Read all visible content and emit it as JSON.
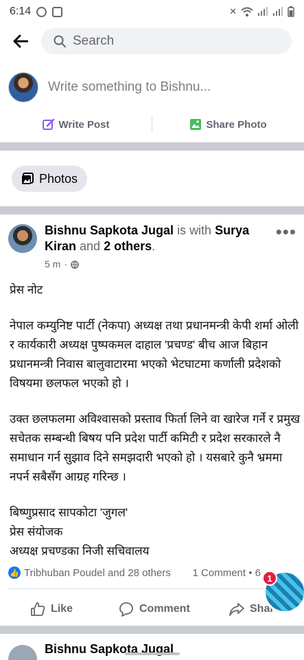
{
  "status": {
    "time": "6:14",
    "icons": [
      "whatsapp-icon",
      "screen-icon",
      "mute-icon",
      "wifi-icon",
      "signal-icon",
      "signal-icon"
    ]
  },
  "topbar": {
    "back_icon": "arrow-left-icon",
    "search_placeholder": "Search"
  },
  "composer": {
    "placeholder": "Write something to Bishnu..."
  },
  "actions": {
    "write_post": "Write Post",
    "share_photo": "Share Photo"
  },
  "photos_button": "Photos",
  "post": {
    "author": "Bishnu Sapkota Jugal",
    "is_with": "is with",
    "tagged": "Surya Kiran",
    "and": "and",
    "others": "2 others",
    "period": ".",
    "time": "5 m",
    "paragraph1": "प्रेस नोट",
    "paragraph2": "नेपाल कम्युनिष्ट पार्टी (नेकपा) अध्यक्ष तथा प्रधानमन्त्री केपी शर्मा ओली र कार्यकारी अध्यक्ष पुष्पकमल दाहाल 'प्रचण्ड' बीच आज बिहान प्रधानमन्त्री निवास बालुवाटारमा भएको भेटघाटमा कर्णाली प्रदेशको विषयमा छलफल भएको हो ।",
    "paragraph3": "उक्त छलफलमा अविश्वासको प्रस्ताव फिर्ता लिने वा खारेज गर्ने र प्रमुख सचेतक सम्बन्धी बिषय पनि प्रदेश पार्टी कमिटी र प्रदेश सरकारले नै समाधान गर्न सुझाव दिने समझदारी भएको हो । यसबारे कुनै भ्रममा नपर्न सबैसँग आग्रह गरिन्छ ।",
    "sig_line1": "बिष्णुप्रसाद सापकोटा 'जुगल'",
    "sig_line2": "प्रेस संयोजक",
    "sig_line3": "अध्यक्ष प्रचण्डका निजी सचिवालय"
  },
  "reactions": {
    "text": "Tribhuban Poudel and 28 others",
    "comments": "1 Comment • 6"
  },
  "post_actions": {
    "like": "Like",
    "comment": "Comment",
    "share": "Share"
  },
  "chathead": {
    "badge": "1"
  },
  "next_post": {
    "author": "Bishnu Sapkota Jugal"
  }
}
